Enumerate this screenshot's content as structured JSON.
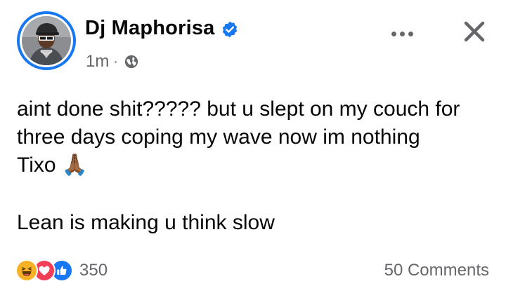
{
  "post": {
    "author": "Dj Maphorisa",
    "verified": true,
    "timestamp": "1m",
    "separator": "·",
    "audience_icon": "globe-icon",
    "more_icon": "more-horizontal-icon",
    "close_icon": "close-icon",
    "text_lines": [
      "aint done shit????? but u slept on my couch for",
      "three days coping my wave now im nothing",
      "Tixo 🙏🏾"
    ],
    "text_line_after_break": "Lean is making u think slow"
  },
  "footer": {
    "reaction_icons": [
      "haha-reaction-icon",
      "love-reaction-icon",
      "like-reaction-icon"
    ],
    "reaction_count": "350",
    "comments": "50 Comments"
  },
  "colors": {
    "brand_blue": "#1877f2",
    "text_primary": "#050505",
    "text_secondary": "#65676b",
    "love_red": "#f33e58",
    "haha_yellow": "#f7b125"
  }
}
